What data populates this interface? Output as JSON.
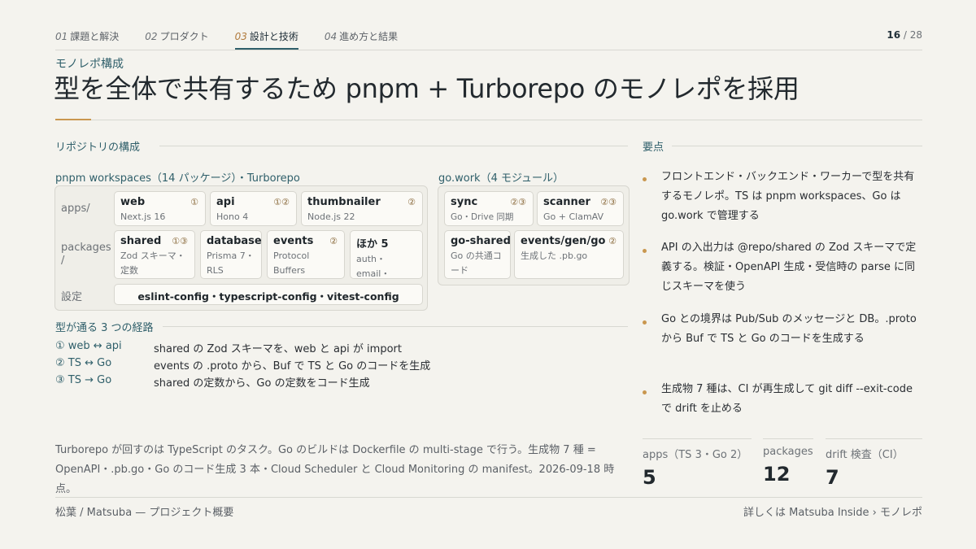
{
  "nav": {
    "tabs": [
      {
        "num": "01",
        "label": "課題と解決"
      },
      {
        "num": "02",
        "label": "プロダクト"
      },
      {
        "num": "03",
        "label": "設計と技術"
      },
      {
        "num": "04",
        "label": "進め方と結果"
      }
    ],
    "page_current": "16",
    "page_total": "28"
  },
  "kicker": "モノレポ構成",
  "title": "型を全体で共有するため pnpm + Turborepo のモノレポを採用",
  "repo": {
    "section_label": "リポジトリの構成",
    "pnpm_label": "pnpm workspaces（14 パッケージ）・Turborepo",
    "gowork_label": "go.work（4 モジュール）",
    "row_labels": {
      "apps": "apps/",
      "packages": "packages /",
      "settings": "設定"
    },
    "apps": [
      {
        "name": "web",
        "mark": "①",
        "desc": "Next.js 16"
      },
      {
        "name": "api",
        "mark": "①②",
        "desc": "Hono 4"
      },
      {
        "name": "thumbnailer",
        "mark": "②",
        "desc": "Node.js 22"
      }
    ],
    "packages": [
      {
        "name": "shared",
        "mark": "①③",
        "desc": "Zod スキーマ・定数"
      },
      {
        "name": "database",
        "mark": "",
        "desc": "Prisma 7・RLS"
      },
      {
        "name": "events",
        "mark": "②",
        "desc": "Protocol Buffers"
      },
      {
        "name": "ほか 5",
        "mark": "",
        "desc": "auth・email・media など"
      }
    ],
    "settings": "eslint-config・typescript-config・vitest-config",
    "go_modules": [
      {
        "name": "sync",
        "mark": "②③",
        "desc": "Go・Drive 同期"
      },
      {
        "name": "scanner",
        "mark": "②③",
        "desc": "Go + ClamAV"
      },
      {
        "name": "go-shared",
        "mark": "",
        "desc": "Go の共通コード"
      },
      {
        "name": "events/gen/go",
        "mark": "②",
        "desc": "生成した .pb.go"
      }
    ]
  },
  "paths": {
    "label": "型が通る 3 つの経路",
    "items": [
      {
        "key": "① web ↔ api",
        "text": "shared の Zod スキーマを、web と api が import"
      },
      {
        "key": "② TS ↔ Go",
        "text": "events の .proto から、Buf で TS と Go のコードを生成"
      },
      {
        "key": "③ TS → Go",
        "text": "shared の定数から、Go の定数をコード生成"
      }
    ]
  },
  "points": {
    "label": "要点",
    "items": [
      "フロントエンド・バックエンド・ワーカーで型を共有するモノレポ。TS は pnpm workspaces、Go は go.work で管理する",
      "API の入出力は @repo/shared の Zod スキーマで定義する。検証・OpenAPI 生成・受信時の parse に同じスキーマを使う",
      "Go との境界は Pub/Sub のメッセージと DB。.proto から Buf で TS と Go のコードを生成する",
      "生成物 7 種は、CI が再生成して git diff --exit-code で drift を止める"
    ]
  },
  "note": "Turborepo が回すのは TypeScript のタスク。Go のビルドは Dockerfile の multi-stage で行う。生成物 7 種 = OpenAPI・.pb.go・Go のコード生成 3 本・Cloud Scheduler と Cloud Monitoring の manifest。2026-09-18 時点。",
  "stats": [
    {
      "label": "apps（TS 3・Go 2）",
      "value": "5"
    },
    {
      "label": "packages",
      "value": "12"
    },
    {
      "label": "drift 検査（CI）",
      "value": "7"
    }
  ],
  "footer": {
    "left": "松葉 / Matsuba — プロジェクト概要",
    "right": "詳しくは Matsuba Inside › モノレポ"
  }
}
